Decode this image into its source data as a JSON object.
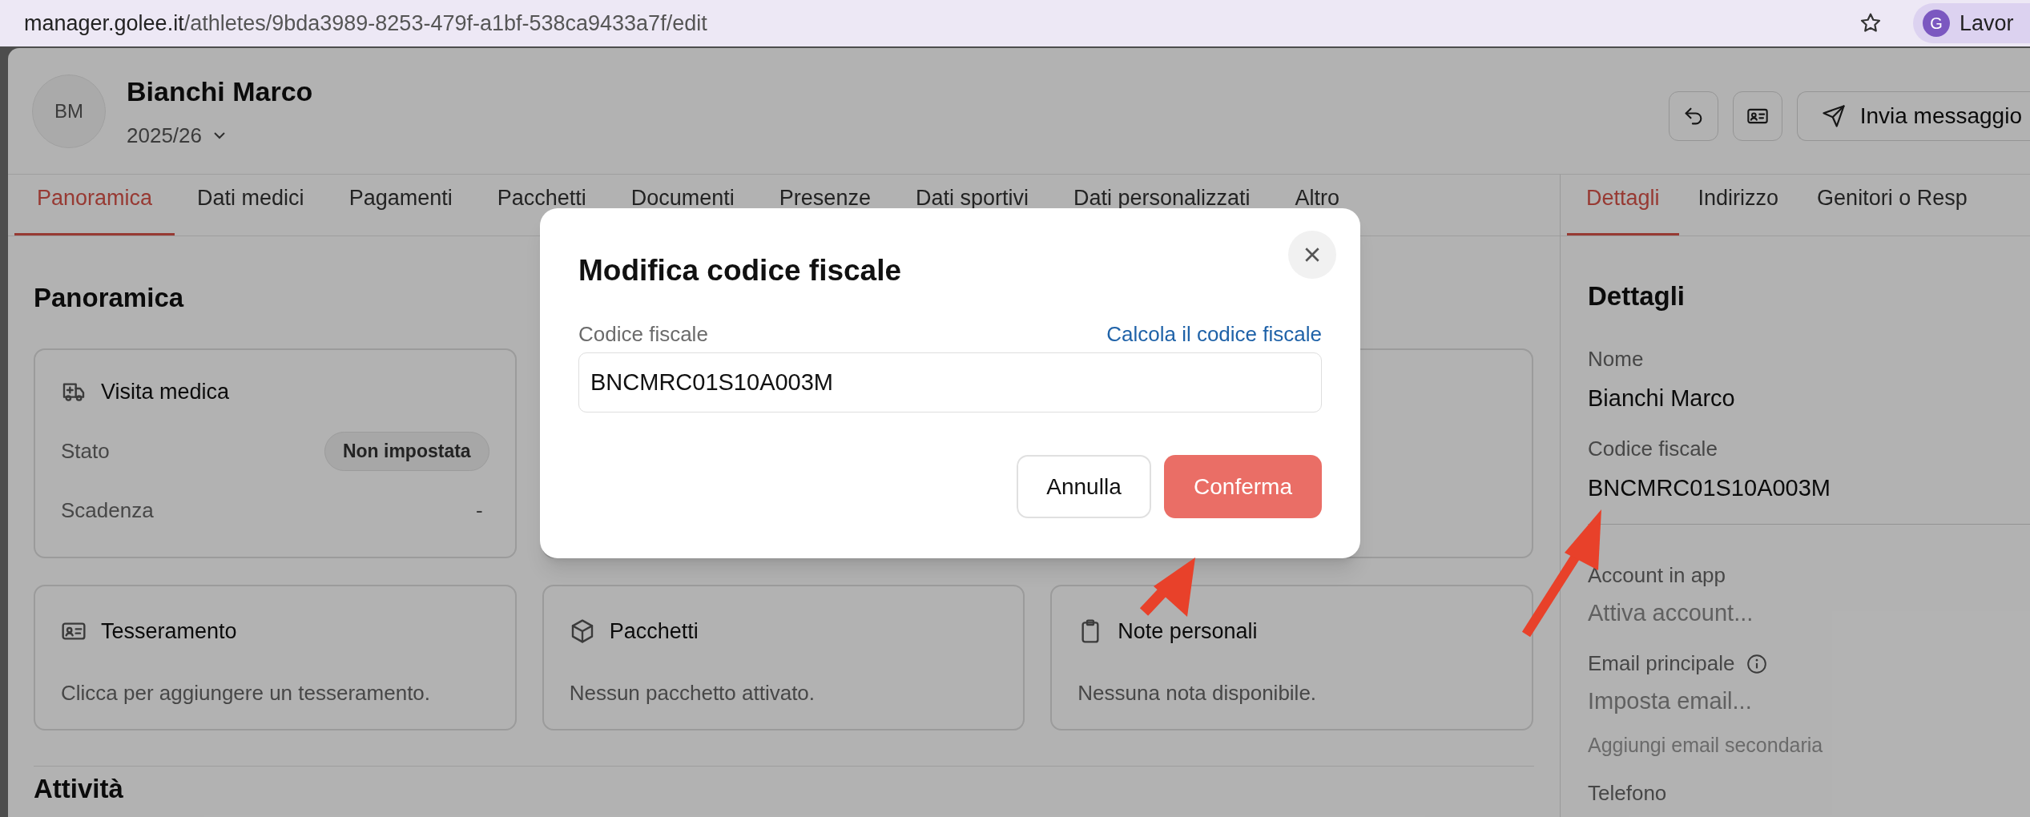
{
  "browser": {
    "url_host": "manager.golee.it",
    "url_path": "/athletes/9bda3989-8253-479f-a1bf-538ca9433a7f/edit",
    "profile": {
      "initial": "G",
      "label": "Lavor"
    }
  },
  "athlete": {
    "initials": "BM",
    "name": "Bianchi Marco",
    "season": "2025/26"
  },
  "header_actions": [
    {
      "kind": "undo"
    },
    {
      "kind": "card"
    },
    {
      "kind": "send",
      "label": "Invia messaggio"
    }
  ],
  "tabs": [
    {
      "label": "Panoramica",
      "selected": true
    },
    {
      "label": "Dati medici",
      "selected": false
    },
    {
      "label": "Pagamenti",
      "selected": false
    },
    {
      "label": "Pacchetti",
      "selected": false
    },
    {
      "label": "Documenti",
      "selected": false
    },
    {
      "label": "Presenze",
      "selected": false
    },
    {
      "label": "Dati sportivi",
      "selected": false
    },
    {
      "label": "Dati personalizzati",
      "selected": false
    },
    {
      "label": "Altro",
      "selected": false
    }
  ],
  "overview": {
    "title": "Panoramica",
    "cards": [
      {
        "kind": "medical",
        "title": "Visita medica",
        "rows": [
          {
            "label": "Stato",
            "value": "Non impostata",
            "kind": "badge"
          },
          {
            "label": "Scadenza",
            "value": "-",
            "kind": "text"
          }
        ]
      },
      {
        "kind": "empty"
      },
      {
        "kind": "empty"
      },
      {
        "kind": "membership",
        "title": "Tesseramento",
        "text": "Clicca per aggiungere un tesseramento."
      },
      {
        "kind": "packages",
        "title": "Pacchetti",
        "text": "Nessun pacchetto attivato."
      },
      {
        "kind": "notes",
        "title": "Note personali",
        "text": "Nessuna nota disponibile."
      }
    ]
  },
  "activities_title": "Attività",
  "detail_tabs": [
    {
      "label": "Dettagli",
      "selected": true
    },
    {
      "label": "Indirizzo",
      "selected": false
    },
    {
      "label": "Genitori o Resp",
      "selected": false
    }
  ],
  "details": {
    "title": "Dettagli",
    "fields": [
      {
        "kind": "value",
        "label": "Nome",
        "value": "Bianchi Marco"
      },
      {
        "kind": "value",
        "label": "Codice fiscale",
        "value": "BNCMRC01S10A003M",
        "divider_after": true
      },
      {
        "kind": "action",
        "label": "Account in app",
        "placeholder": "Attiva account..."
      },
      {
        "kind": "action",
        "label": "Email principale",
        "info": true,
        "placeholder": "Imposta email...",
        "extra": "Aggiungi email secondaria"
      },
      {
        "kind": "label_only",
        "label": "Telefono"
      }
    ]
  },
  "modal": {
    "title": "Modifica codice fiscale",
    "field_label": "Codice fiscale",
    "link": "Calcola il codice fiscale",
    "value": "BNCMRC01S10A003M",
    "buttons": [
      {
        "label": "Annulla",
        "kind": "secondary"
      },
      {
        "label": "Conferma",
        "kind": "primary"
      }
    ]
  }
}
